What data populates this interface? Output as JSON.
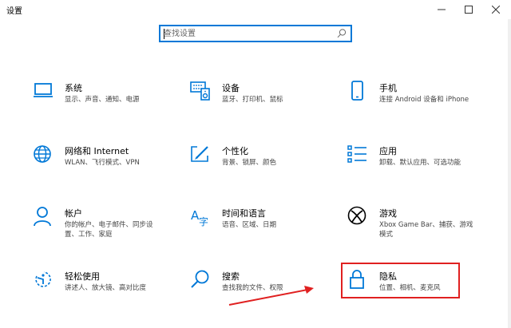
{
  "window": {
    "title": "设置"
  },
  "search": {
    "placeholder": "查找设置"
  },
  "colors": {
    "accent": "#0078d7",
    "highlight": "#e02020"
  },
  "tiles": [
    {
      "title": "系统",
      "desc": "显示、声音、通知、电源",
      "icon": "laptop-icon"
    },
    {
      "title": "设备",
      "desc": "蓝牙、打印机、鼠标",
      "icon": "devices-icon"
    },
    {
      "title": "手机",
      "desc": "连接 Android 设备和 iPhone",
      "icon": "phone-icon"
    },
    {
      "title": "网络和 Internet",
      "desc": "WLAN、飞行模式、VPN",
      "icon": "globe-icon"
    },
    {
      "title": "个性化",
      "desc": "背景、锁屏、颜色",
      "icon": "personalization-icon"
    },
    {
      "title": "应用",
      "desc": "卸载、默认应用、可选功能",
      "icon": "apps-icon"
    },
    {
      "title": "帐户",
      "desc1": "你的帐户、电子邮件、同步设",
      "desc2": "置、工作、家庭",
      "icon": "person-icon"
    },
    {
      "title": "时间和语言",
      "desc": "语音、区域、日期",
      "icon": "time-language-icon"
    },
    {
      "title": "游戏",
      "desc1": "Xbox Game Bar、捕获、游戏",
      "desc2": "模式",
      "icon": "xbox-icon"
    },
    {
      "title": "轻松使用",
      "desc": "讲述人、放大镜、高对比度",
      "icon": "ease-of-access-icon"
    },
    {
      "title": "搜索",
      "desc": "查找我的文件、权限",
      "icon": "search-icon"
    },
    {
      "title": "隐私",
      "desc": "位置、相机、麦克风",
      "icon": "lock-icon"
    }
  ]
}
